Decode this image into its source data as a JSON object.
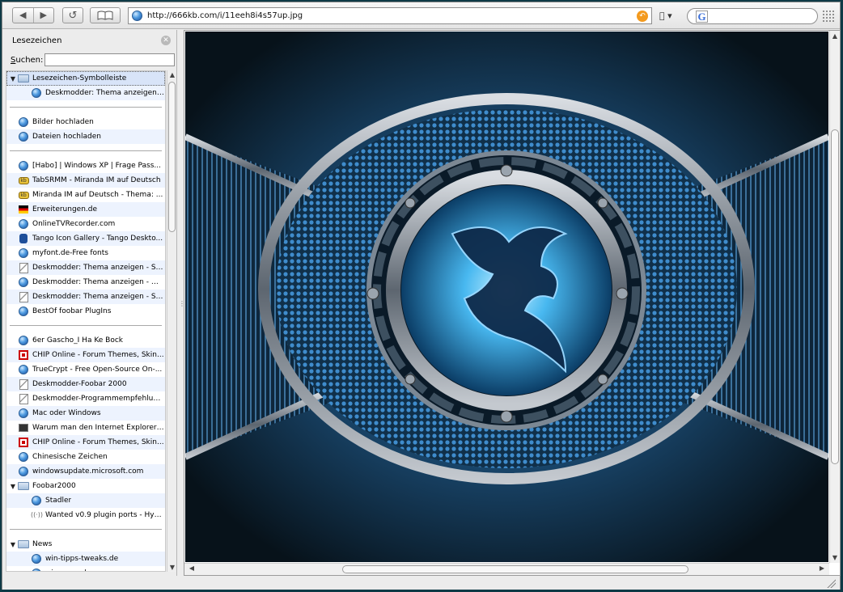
{
  "toolbar": {
    "back_icon": "◀",
    "forward_icon": "▶",
    "reload_icon": "↺",
    "bookmarks_icon": "book-icon",
    "url": "http://666kb.com/i/11eeh8i4s57up.jpg",
    "search_placeholder": "",
    "search_engine": "G",
    "apple_menu": "▾"
  },
  "sidebar": {
    "title": "Lesezeichen",
    "search_label": "Suchen:",
    "search_value": "",
    "items": [
      {
        "type": "folder",
        "label": "Lesezeichen-Symbolleiste",
        "open": true,
        "selected": true
      },
      {
        "type": "globe",
        "label": "Deskmodder: Thema anzeigen - ...",
        "indent": 1
      },
      {
        "type": "separator"
      },
      {
        "type": "globe",
        "label": "Bilder hochladen"
      },
      {
        "type": "globe",
        "label": "Dateien hochladen"
      },
      {
        "type": "separator"
      },
      {
        "type": "globe",
        "label": "[Habo] | Windows XP | Frage Pass..."
      },
      {
        "type": "kb",
        "label": "TabSRMM - Miranda IM auf Deutsch"
      },
      {
        "type": "kb",
        "label": "Miranda IM auf Deutsch - Thema: ..."
      },
      {
        "type": "flag",
        "label": "Erweiterungen.de"
      },
      {
        "type": "globe",
        "label": "OnlineTVRecorder.com"
      },
      {
        "type": "feet",
        "label": "Tango Icon Gallery - Tango Deskto..."
      },
      {
        "type": "globe",
        "label": "myfont.de-Free fonts"
      },
      {
        "type": "page",
        "label": "Deskmodder: Thema anzeigen - Sa..."
      },
      {
        "type": "globe",
        "label": "Deskmodder: Thema anzeigen - Wi..."
      },
      {
        "type": "page",
        "label": "Deskmodder: Thema anzeigen - Sa..."
      },
      {
        "type": "globe",
        "label": "BestOf foobar PlugIns"
      },
      {
        "type": "separator"
      },
      {
        "type": "globe",
        "label": "6er Gascho_I Ha Ke Bock"
      },
      {
        "type": "chip",
        "label": "CHIP Online - Forum Themes, Skin..."
      },
      {
        "type": "globe",
        "label": "TrueCrypt - Free Open-Source On-..."
      },
      {
        "type": "page",
        "label": "Deskmodder-Foobar 2000"
      },
      {
        "type": "page",
        "label": "Deskmodder-Programmempfehlung..."
      },
      {
        "type": "globe",
        "label": "Mac oder Windows"
      },
      {
        "type": "term",
        "label": "Warum man den Internet Explorer ..."
      },
      {
        "type": "chip",
        "label": "CHIP Online - Forum Themes, Skin..."
      },
      {
        "type": "globe",
        "label": "Chinesische Zeichen"
      },
      {
        "type": "globe",
        "label": "windowsupdate.microsoft.com"
      },
      {
        "type": "folder",
        "label": "Foobar2000",
        "open": true
      },
      {
        "type": "globe",
        "label": "Stadler",
        "indent": 1
      },
      {
        "type": "rss",
        "label": "Wanted v0.9 plugin ports - Hyd...",
        "indent": 1
      },
      {
        "type": "separator"
      },
      {
        "type": "folder",
        "label": "News",
        "open": true
      },
      {
        "type": "globe",
        "label": "win-tipps-tweaks.de",
        "indent": 1
      },
      {
        "type": "globe",
        "label": "win-news.de",
        "indent": 1
      }
    ]
  },
  "content": {
    "image_alt": "dragon emblem wallpaper"
  },
  "colors": {
    "accent": "#4f9be0",
    "window_bg": "#ececec",
    "selected_row": "#d8e4f8",
    "alt_row": "#edf3fe"
  }
}
